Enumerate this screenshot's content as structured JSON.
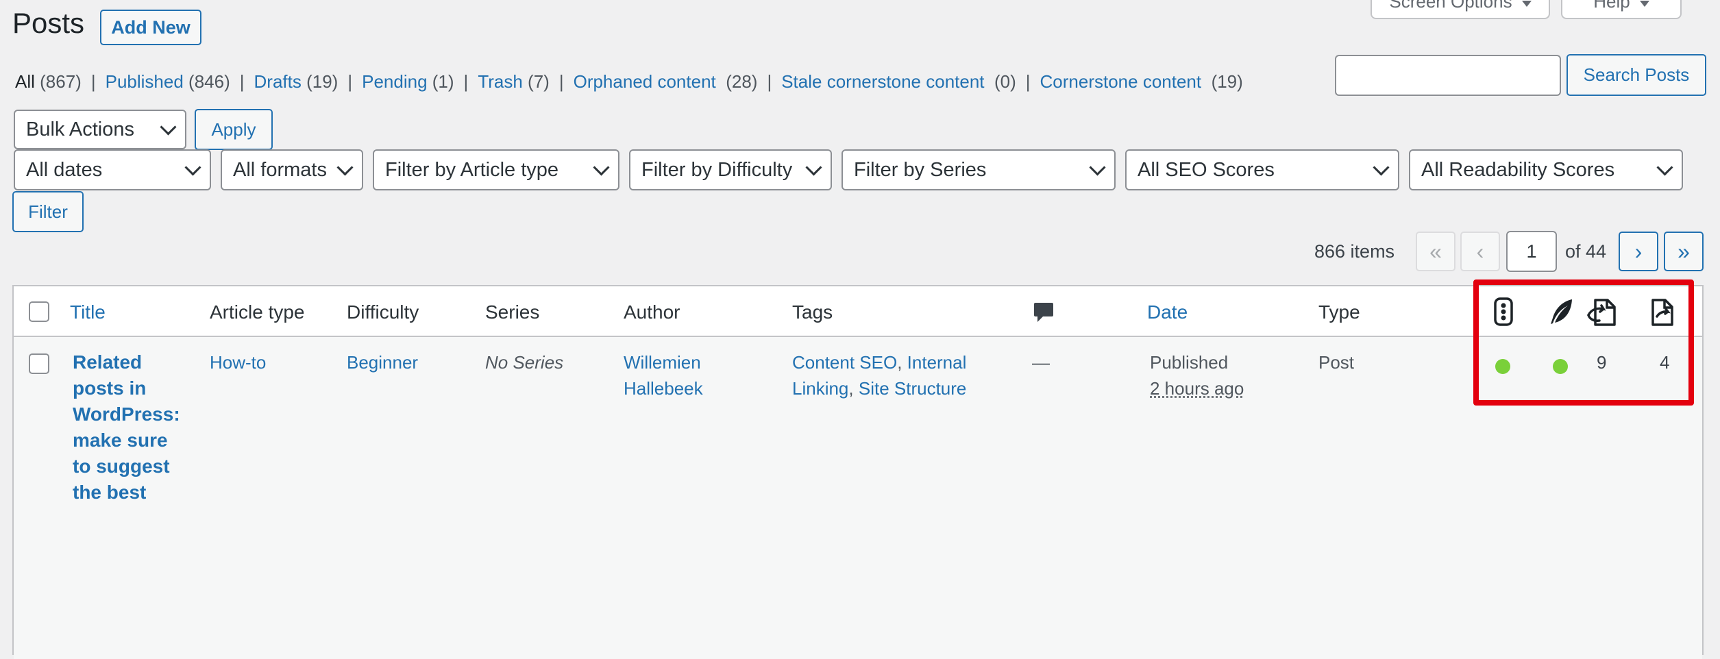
{
  "header": {
    "title": "Posts",
    "add_new": "Add New",
    "screen_options": "Screen Options",
    "help": "Help"
  },
  "views": [
    {
      "label": "All",
      "count": "(867)",
      "current": true
    },
    {
      "label": "Published",
      "count": "(846)"
    },
    {
      "label": "Drafts",
      "count": "(19)"
    },
    {
      "label": "Pending",
      "count": "(1)"
    },
    {
      "label": "Trash",
      "count": "(7)"
    },
    {
      "label": "Orphaned content",
      "count": "(28)"
    },
    {
      "label": "Stale cornerstone content",
      "count": "(0)"
    },
    {
      "label": "Cornerstone content",
      "count": "(19)"
    }
  ],
  "search": {
    "value": "",
    "button": "Search Posts"
  },
  "bulk": {
    "label": "Bulk Actions",
    "apply": "Apply"
  },
  "filters": {
    "dates": "All dates",
    "formats": "All formats",
    "article_type": "Filter by Article type",
    "difficulty": "Filter by Difficulty",
    "series": "Filter by Series",
    "seo": "All SEO Scores",
    "readability": "All Readability Scores",
    "button": "Filter"
  },
  "pagination": {
    "items": "866 items",
    "first": "«",
    "prev": "‹",
    "current": "1",
    "of": "of 44",
    "next": "›",
    "last": "»"
  },
  "columns": {
    "title": "Title",
    "article_type": "Article type",
    "difficulty": "Difficulty",
    "series": "Series",
    "author": "Author",
    "tags": "Tags",
    "comments_icon": "comment-bubble-icon",
    "date": "Date",
    "type": "Type",
    "seo_icon": "traffic-light-icon",
    "readability_icon": "feather-icon",
    "incoming_links_icon": "incoming-link-icon",
    "outgoing_links_icon": "outgoing-link-icon"
  },
  "rows": [
    {
      "title": "Related posts in WordPress: make sure to suggest the best",
      "article_type": "How-to",
      "difficulty": "Beginner",
      "series": "No Series",
      "author_first": "Willemien",
      "author_last": "Hallebeek",
      "tags": [
        "Content SEO",
        "Internal Linking",
        "Site Structure"
      ],
      "comments": "—",
      "status": "Published",
      "date": "2 hours ago",
      "type": "Post",
      "seo_color": "#7ad03a",
      "readability_color": "#7ad03a",
      "incoming_links": "9",
      "outgoing_links": "4"
    }
  ],
  "colors": {
    "link": "#2271b1",
    "highlight": "#e3000e",
    "good": "#7ad03a"
  }
}
